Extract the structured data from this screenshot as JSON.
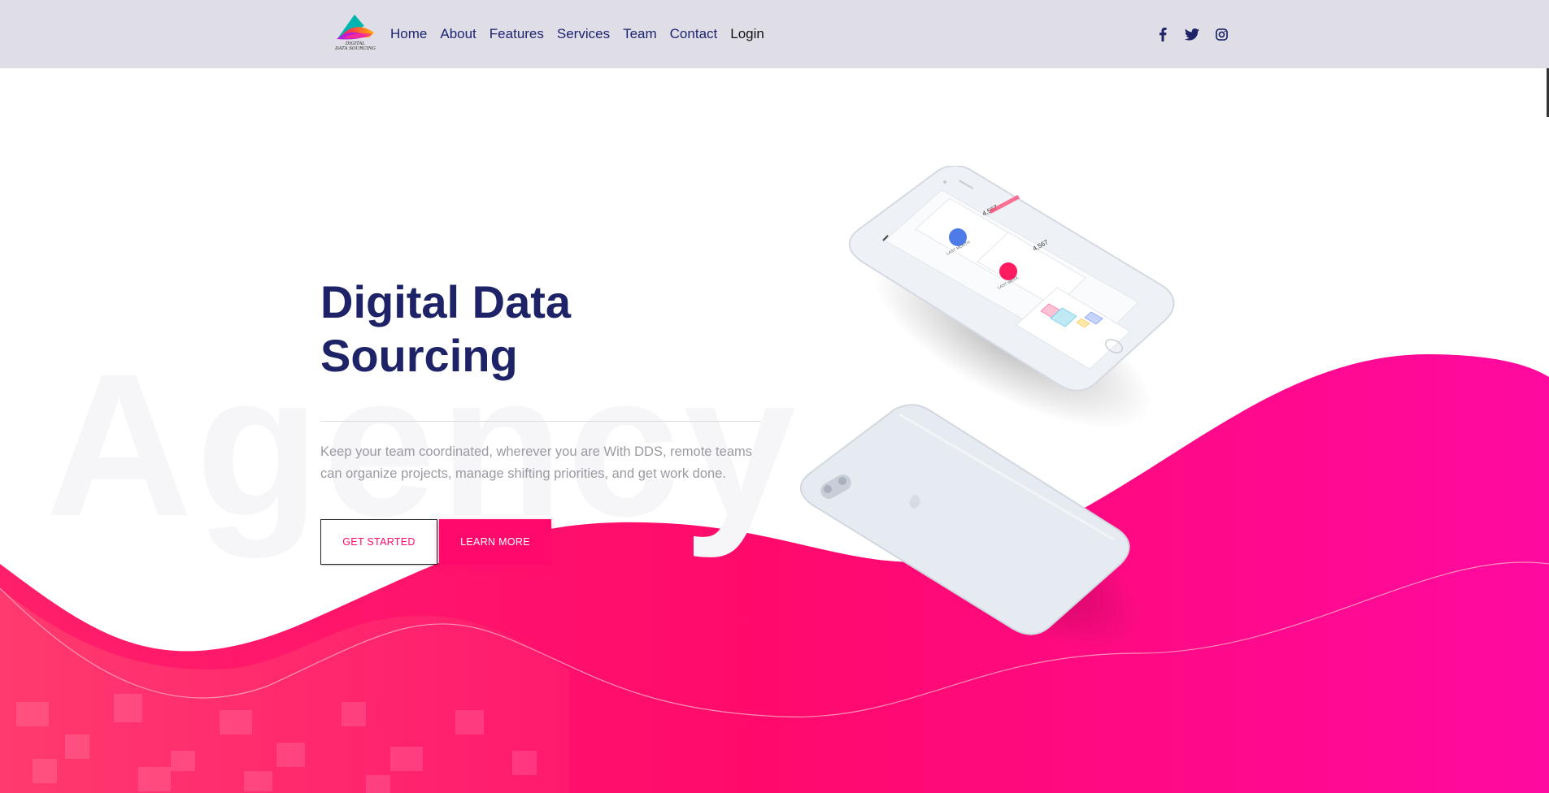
{
  "brand": {
    "logo_text_line1": "DIGITAL",
    "logo_text_line2": "DATA SOURCING"
  },
  "nav": {
    "items": [
      {
        "label": "Home"
      },
      {
        "label": "About"
      },
      {
        "label": "Features"
      },
      {
        "label": "Services"
      },
      {
        "label": "Team"
      },
      {
        "label": "Contact"
      },
      {
        "label": "Login"
      }
    ]
  },
  "socials": [
    {
      "icon": "facebook-icon"
    },
    {
      "icon": "twitter-icon"
    },
    {
      "icon": "instagram-icon"
    }
  ],
  "hero": {
    "watermark": "Agency",
    "title_line1": "Digital Data",
    "title_line2": "Sourcing",
    "description": "Keep your team coordinated, wherever you are With DDS, remote teams can organize projects, manage shifting priorities, and get work done.",
    "primary_button": "GET STARTED",
    "secondary_button": "LEARN MORE"
  },
  "phone_mockup": {
    "stat1_value": "4,567",
    "stat1_label": "LAST MONTH",
    "stat2_value": "4,567",
    "stat2_label": "LAST WEEK"
  },
  "colors": {
    "accent": "#ff0a6c",
    "navy": "#1d2366",
    "navbar_bg": "#dfdee7"
  }
}
